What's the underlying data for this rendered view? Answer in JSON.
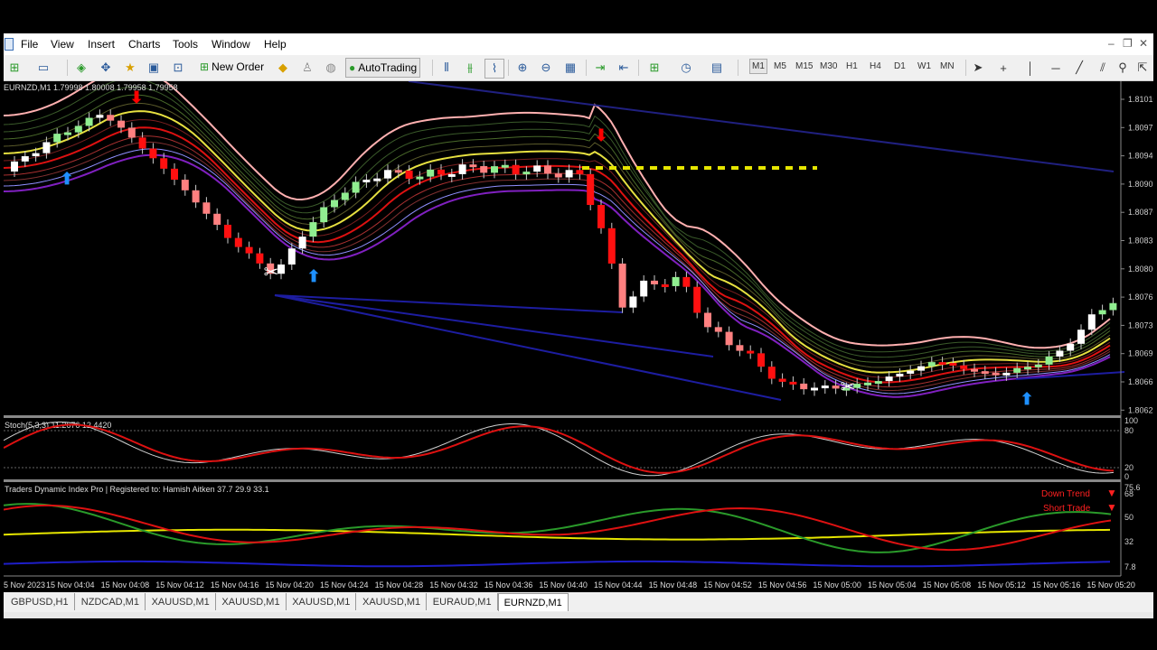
{
  "menu": [
    "File",
    "View",
    "Insert",
    "Charts",
    "Tools",
    "Window",
    "Help"
  ],
  "toolbar": {
    "new_order": "New Order",
    "auto_trading": "AutoTrading",
    "timeframes": [
      "M1",
      "M5",
      "M15",
      "M30",
      "H1",
      "H4",
      "D1",
      "W1",
      "MN"
    ]
  },
  "chart": {
    "header": "EURNZD,M1  1.79998 1.80008 1.79958 1.79958",
    "price_labels": [
      "1.81010",
      "1.80975",
      "1.80940",
      "1.80905",
      "1.80870",
      "1.80835",
      "1.80800",
      "1.80765",
      "1.80730",
      "1.80695",
      "1.80660",
      "1.80625"
    ],
    "stoch_label": "Stoch(5,3,3) 11.2676 12.4420",
    "stoch_levels": [
      "100",
      "80",
      "20",
      "0"
    ],
    "tdi_label": "Traders Dynamic Index Pro | Registered to: Hamish Aitken 37.7 29.9 33.1",
    "tdi_levels": [
      "75.6",
      "68",
      "50",
      "32",
      "7.8"
    ],
    "down_trend": "Down Trend",
    "short_trade": "Short Trade",
    "time_labels": [
      "5 Nov 2023",
      "15 Nov 04:04",
      "15 Nov 04:08",
      "15 Nov 04:12",
      "15 Nov 04:16",
      "15 Nov 04:20",
      "15 Nov 04:24",
      "15 Nov 04:28",
      "15 Nov 04:32",
      "15 Nov 04:36",
      "15 Nov 04:40",
      "15 Nov 04:44",
      "15 Nov 04:48",
      "15 Nov 04:52",
      "15 Nov 04:56",
      "15 Nov 05:00",
      "15 Nov 05:04",
      "15 Nov 05:08",
      "15 Nov 05:12",
      "15 Nov 05:16",
      "15 Nov 05:20"
    ]
  },
  "tabs": [
    "GBPUSD,H1",
    "NZDCAD,M1",
    "XAUUSD,M1",
    "XAUUSD,M1",
    "XAUUSD,M1",
    "XAUUSD,M1",
    "EURAUD,M1",
    "EURNZD,M1"
  ],
  "active_tab": "EURNZD,M1",
  "colors": {
    "bull": "#90ee90",
    "bear": "#ff0000",
    "up_arrow": "#1e90ff",
    "down_arrow": "#ff0000"
  }
}
